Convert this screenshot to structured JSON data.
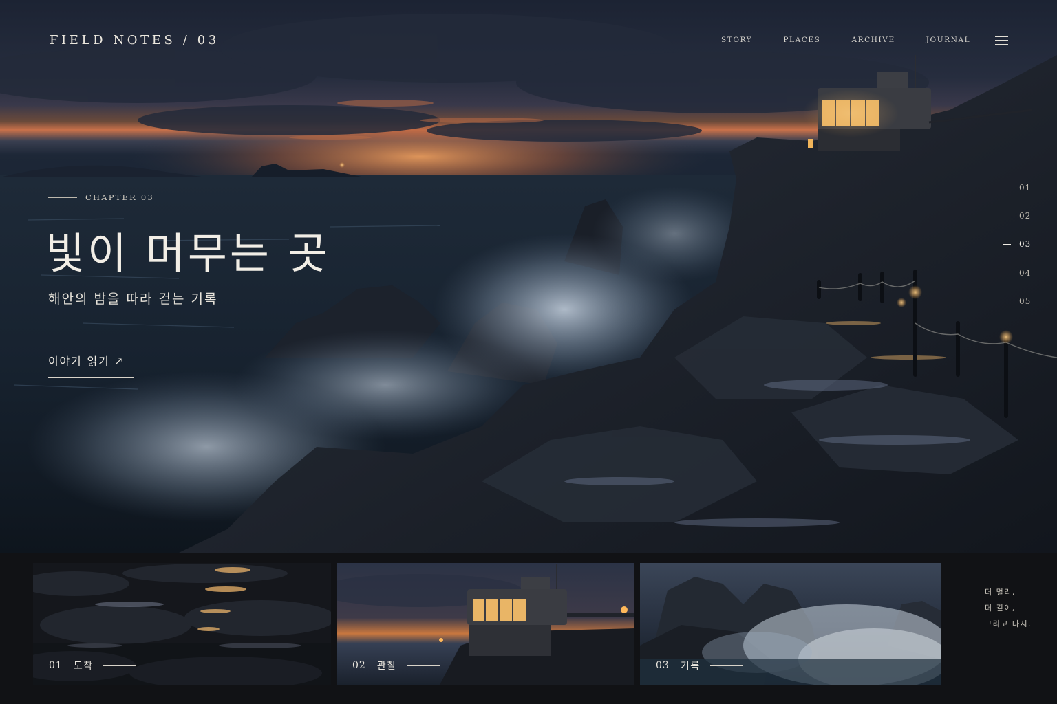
{
  "header": {
    "brand": "FIELD NOTES / 03",
    "nav": [
      "STORY",
      "PLACES",
      "ARCHIVE",
      "JOURNAL"
    ],
    "menu_icon": "hamburger-menu-icon"
  },
  "hero": {
    "chapter": "CHAPTER 03",
    "title": "빛이 머무는 곳",
    "subtitle": "해안의 밤을 따라 걷는 기록",
    "cta": {
      "label": "이야기 읽기",
      "icon": "arrow-up-right-icon",
      "glyph": "↗"
    },
    "pager": {
      "items": [
        "01",
        "02",
        "03",
        "04",
        "05"
      ],
      "active": "03"
    }
  },
  "gallery": {
    "items": [
      {
        "number": "01",
        "title": "도착"
      },
      {
        "number": "02",
        "title": "관찰"
      },
      {
        "number": "03",
        "title": "기록"
      }
    ],
    "poem": [
      "더 멀리,",
      "더 깊이,",
      "그리고 다시."
    ]
  },
  "colors": {
    "accent_glow": "#f2b25a",
    "sunset": "#d9783f",
    "background": "#111215"
  }
}
